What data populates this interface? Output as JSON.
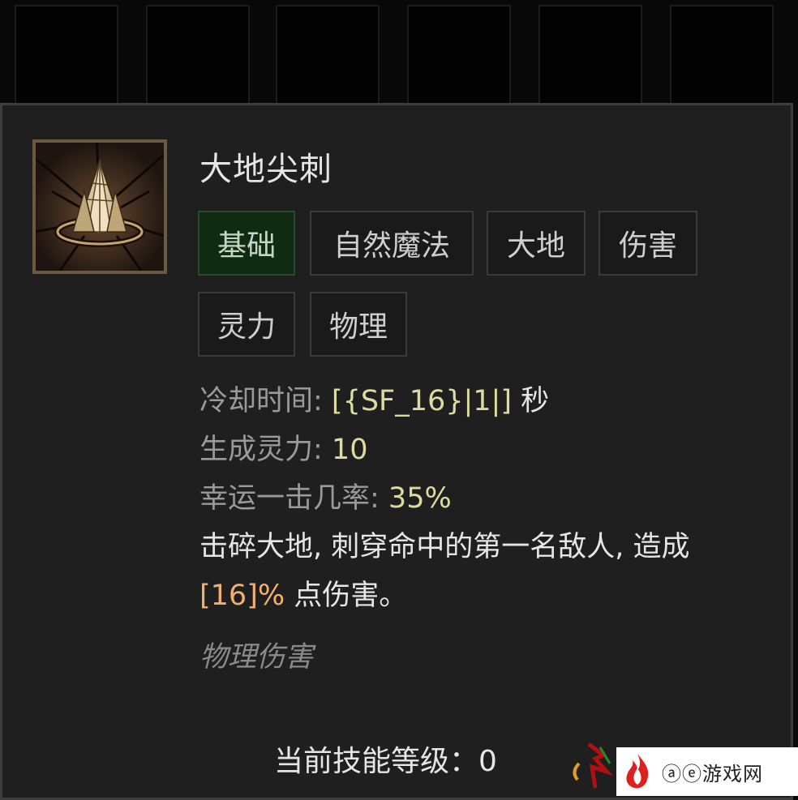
{
  "skill": {
    "name": "大地尖刺",
    "icon": "earth-spike-icon",
    "tags": [
      "基础",
      "自然魔法",
      "大地",
      "伤害",
      "灵力",
      "物理"
    ],
    "stats": [
      {
        "label": "冷却时间: ",
        "value": "[{SF_16}|1|]",
        "suffix": " 秒"
      },
      {
        "label": "生成灵力: ",
        "value": "10",
        "suffix": ""
      },
      {
        "label": "幸运一击几率: ",
        "value": "35%",
        "suffix": ""
      }
    ],
    "description": {
      "line1": "击碎大地, 刺穿命中的第一名敌人, 造成",
      "damage_value": "[16]%",
      "line2_rest": " 点伤害。"
    },
    "damage_type": "物理伤害",
    "current_level_label": "当前技能等级：",
    "current_level": "0"
  },
  "watermark": {
    "text": "ⓐⓔ游戏网"
  },
  "colors": {
    "panel_bg": "#1f1f1f",
    "tag_primary_bg": "#0f2b12",
    "value_yellow": "#dcdca0",
    "value_orange": "#f0b070"
  }
}
